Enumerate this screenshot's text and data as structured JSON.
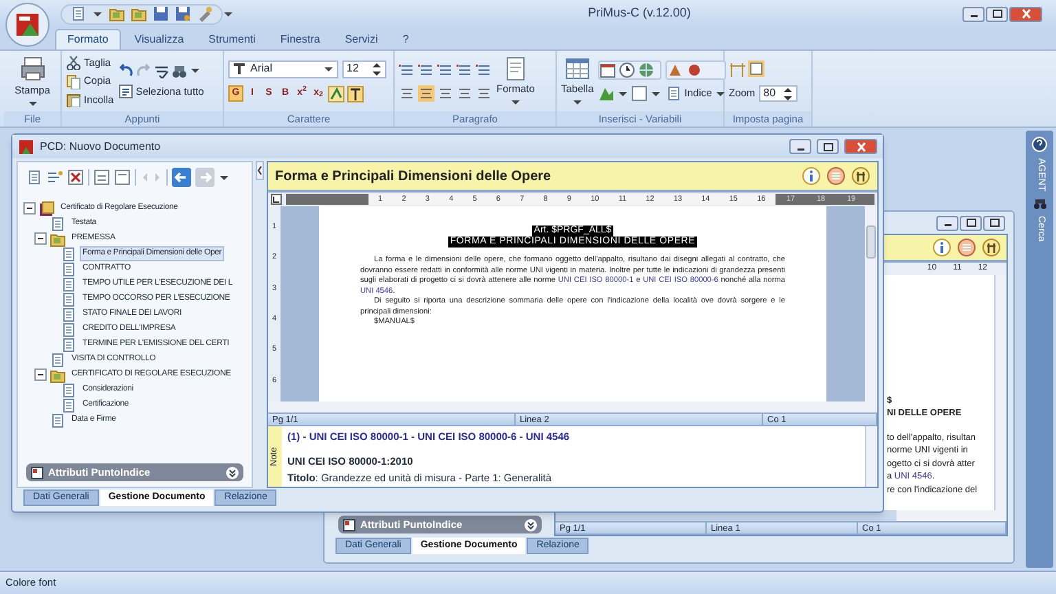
{
  "app": {
    "title": "PriMus-C (v.12.00)"
  },
  "ribbon_tabs": [
    {
      "label": "Formato",
      "selected": true
    },
    {
      "label": "Visualizza",
      "selected": false
    },
    {
      "label": "Strumenti",
      "selected": false
    },
    {
      "label": "Finestra",
      "selected": false
    },
    {
      "label": "Servizi",
      "selected": false
    },
    {
      "label": "?",
      "selected": false
    }
  ],
  "ribbon": {
    "file": {
      "label": "File",
      "print": "Stampa"
    },
    "clipboard": {
      "label": "Appunti",
      "cut": "Taglia",
      "copy": "Copia",
      "paste": "Incolla",
      "select_all": "Seleziona tutto"
    },
    "font": {
      "label": "Carattere",
      "family": "Arial",
      "size": "12",
      "styles": [
        {
          "label": "G",
          "on": true
        },
        {
          "label": "I",
          "on": false
        },
        {
          "label": "S",
          "on": false
        },
        {
          "label": "B",
          "on": false
        },
        {
          "label": "x$^{2}$",
          "on": false
        },
        {
          "label": "x$_{2}$",
          "on": false
        }
      ]
    },
    "paragraph": {
      "label": "Paragrafo",
      "format": "Formato"
    },
    "insert": {
      "label": "Inserisci - Variabili",
      "table": "Tabella",
      "index": "Indice"
    },
    "page": {
      "label": "Imposta pagina",
      "zoom_label": "Zoom",
      "zoom": "80"
    }
  },
  "side_panel": [
    "AGENT",
    "Cerca"
  ],
  "front_window": {
    "title": "PCD: Nuovo Documento",
    "tree": [
      {
        "label": "Certificato di Regolare Esecuzione",
        "kind": "root",
        "selected": false,
        "expanded": true,
        "children": [
          {
            "label": "Testata",
            "kind": "page",
            "selected": false
          },
          {
            "label": "PREMESSA",
            "kind": "folder",
            "selected": false,
            "expanded": true,
            "children": [
              {
                "label": "Forma e Principali Dimensioni delle Oper",
                "kind": "page",
                "selected": true
              },
              {
                "label": "CONTRATTO",
                "kind": "page",
                "selected": false
              },
              {
                "label": "TEMPO UTILE PER L'ESECUZIONE DEI L",
                "kind": "page",
                "selected": false
              },
              {
                "label": "TEMPO OCCORSO PER L'ESECUZIONE",
                "kind": "page",
                "selected": false
              },
              {
                "label": "STATO FINALE DEI LAVORI",
                "kind": "page",
                "selected": false
              },
              {
                "label": "CREDITO DELL'IMPRESA",
                "kind": "page",
                "selected": false
              },
              {
                "label": "TERMINE PER L'EMISSIONE DEL CERTI",
                "kind": "page",
                "selected": false
              }
            ]
          },
          {
            "label": "VISITA DI CONTROLLO",
            "kind": "page",
            "selected": false
          },
          {
            "label": "CERTIFICATO DI REGOLARE ESECUZIONE",
            "kind": "folder",
            "selected": false,
            "expanded": true,
            "children": [
              {
                "label": "Considerazioni",
                "kind": "page",
                "selected": false
              },
              {
                "label": "Certificazione",
                "kind": "page",
                "selected": false
              }
            ]
          },
          {
            "label": "Data e Firme",
            "kind": "page",
            "selected": false
          }
        ]
      }
    ],
    "attributes_panel": "Attributi PuntoIndice",
    "bottom_tabs": [
      {
        "label": "Dati Generali",
        "selected": false
      },
      {
        "label": "Gestione Documento",
        "selected": true
      },
      {
        "label": "Relazione",
        "selected": false
      }
    ],
    "document": {
      "heading": "Forma e Principali Dimensioni delle Opere",
      "ruler": [
        "1",
        "2",
        "3",
        "4",
        "5",
        "6",
        "7",
        "8",
        "9",
        "10",
        "11",
        "12",
        "13",
        "14",
        "15",
        "16",
        "17",
        "18",
        "19"
      ],
      "vertical_ruler": [
        "1",
        "2",
        "3",
        "4",
        "5",
        "6"
      ],
      "article": "Art. $PRGF_ALL$",
      "title": "FORMA E PRINCIPALI DIMENSIONI DELLE OPERE",
      "paragraphs": [
        [
          {
            "kind": "plain",
            "text": "La forma e le dimensioni delle opere, che formano oggetto dell'appalto, risultano dai disegni allegati al contratto, che dovranno essere redatti in conformità alle norme UNI vigenti in materia. Inoltre per tutte le indicazioni di grandezza presenti sugli elaborati di progetto ci si dovrà attenere alle norme "
          },
          {
            "kind": "link",
            "text": "UNI CEI ISO 80000-1"
          },
          {
            "kind": "plain",
            "text": " e "
          },
          {
            "kind": "link",
            "text": "UNI CEI ISO 80000-6"
          },
          {
            "kind": "plain",
            "text": " nonché alla norma "
          },
          {
            "kind": "link",
            "text": "UNI 4546"
          },
          {
            "kind": "plain",
            "text": "."
          }
        ],
        [
          {
            "kind": "plain",
            "text": "Di seguito si riporta una descrizione sommaria delle opere con l'indicazione della località ove dovrà sorgere e le principali dimensioni:"
          }
        ]
      ],
      "variable": "$MANUAL$"
    },
    "status": [
      "Pg 1/1",
      "Linea 2",
      "Co 1"
    ],
    "note": {
      "tab": "Note",
      "heading": "(1) - UNI CEI ISO 80000-1 - UNI CEI ISO 80000-6 - UNI 4546",
      "line_1": "UNI CEI ISO 80000-1:2010",
      "line_2": "**Titolo**: Grandezze ed unità di misura - Parte 1: Generalità"
    }
  },
  "back_window": {
    "ruler": [
      "10",
      "11",
      "12"
    ],
    "lines": [
      [
        {
          "kind": "bold",
          "text": "$"
        }
      ],
      [
        {
          "kind": "bold",
          "text": "NI DELLE OPERE"
        }
      ],
      [
        {
          "kind": "plain",
          "text": "to dell'appalto, risultan"
        }
      ],
      [
        {
          "kind": "plain",
          "text": "norme UNI vigenti in"
        }
      ],
      [
        {
          "kind": "plain",
          "text": "ogetto ci si dovrà atter"
        }
      ],
      [
        {
          "kind": "plain",
          "text": "a "
        },
        {
          "kind": "link",
          "text": "UNI 4546"
        },
        {
          "kind": "plain",
          "text": "."
        }
      ],
      [
        {
          "kind": "plain",
          "text": "re con l'indicazione del"
        }
      ]
    ],
    "attributes_panel": "Attributi PuntoIndice",
    "status": [
      "Pg 1/1",
      "Linea 1",
      "Co 1"
    ],
    "bottom_tabs": [
      {
        "label": "Dati Generali",
        "selected": false
      },
      {
        "label": "Gestione Documento",
        "selected": true
      },
      {
        "label": "Relazione",
        "selected": false
      }
    ]
  },
  "status_bar": "Colore font"
}
